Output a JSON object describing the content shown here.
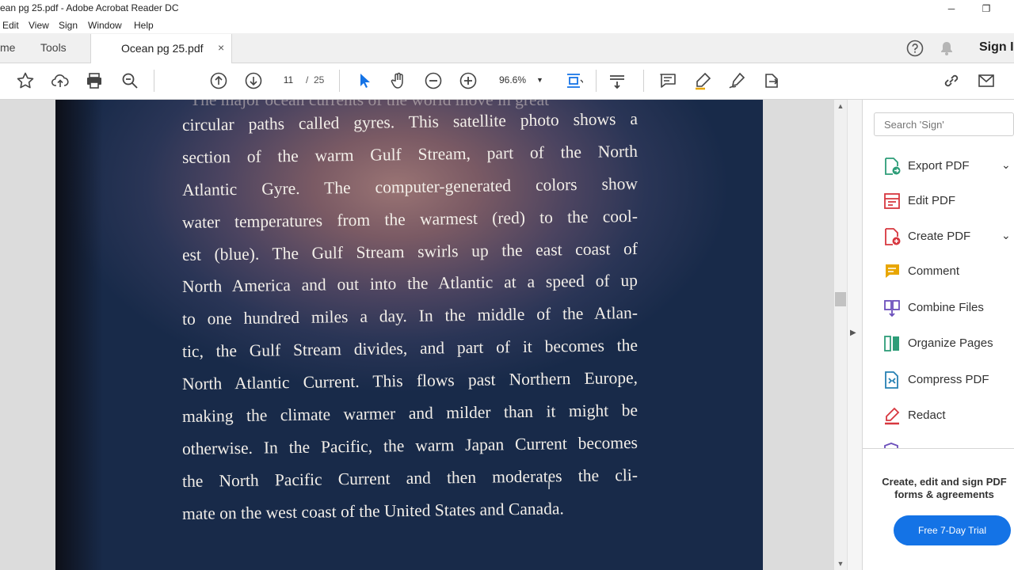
{
  "window": {
    "title": "ean pg 25.pdf - Adobe Acrobat Reader DC",
    "minimize_glyph": "─",
    "restore_glyph": "❐"
  },
  "menu": [
    "Edit",
    "View",
    "Sign",
    "Window",
    "Help"
  ],
  "tabs": {
    "home_label": "me",
    "tools_label": "Tools",
    "document_label": "Ocean pg 25.pdf",
    "close_glyph": "×"
  },
  "header": {
    "sign_in_label": "Sign I"
  },
  "toolbar": {
    "current_page": "11",
    "page_separator": "/",
    "total_pages": "25",
    "zoom": "96.6%",
    "icons": [
      "bookmark-star-icon",
      "upload-cloud-icon",
      "print-icon",
      "search-zoom-icon",
      "page-up-icon",
      "page-down-icon",
      "select-cursor-icon",
      "hand-pan-icon",
      "zoom-out-icon",
      "zoom-in-icon",
      "fit-page-icon",
      "scroll-mode-icon",
      "comment-icon",
      "highlight-pen-icon",
      "sign-icon",
      "share-icon",
      "link-icon",
      "email-icon"
    ]
  },
  "document": {
    "cut_top_line": "The major ocean currents of the world move in great",
    "lines": [
      "circular paths called gyres. This satellite photo shows a",
      "section of the warm Gulf Stream, part of the North",
      "Atlantic Gyre. The computer-generated colors show",
      "water temperatures from the warmest (red) to the cool-",
      "est (blue). The Gulf Stream swirls up the east coast of",
      "North America and out into the Atlantic at a speed of up",
      "to one hundred miles a day. In the middle of the Atlan-",
      "tic, the Gulf Stream divides, and part of it becomes the",
      "North Atlantic Current. This flows past Northern Europe,",
      "making the climate warmer and milder than it might be",
      "otherwise. In the Pacific, the warm Japan Current becomes",
      "the North Pacific Current and then moderates the cli-",
      "mate on the west coast of the United States and Canada."
    ]
  },
  "scrollbar": {
    "up_glyph": "▲",
    "down_glyph": "▼",
    "pane_toggle_glyph": "▶"
  },
  "right_pane": {
    "search_placeholder": "Search 'Sign'",
    "items": [
      {
        "label": "Export PDF",
        "icon": "export-pdf-icon",
        "color": "#2d9d78",
        "chevron": "⌄"
      },
      {
        "label": "Edit PDF",
        "icon": "edit-pdf-icon",
        "color": "#d7373f",
        "chevron": ""
      },
      {
        "label": "Create PDF",
        "icon": "create-pdf-icon",
        "color": "#d7373f",
        "chevron": "⌄"
      },
      {
        "label": "Comment",
        "icon": "comment-tool-icon",
        "color": "#e8a600",
        "chevron": ""
      },
      {
        "label": "Combine Files",
        "icon": "combine-files-icon",
        "color": "#6b4fbb",
        "chevron": ""
      },
      {
        "label": "Organize Pages",
        "icon": "organize-pages-icon",
        "color": "#2d9d78",
        "chevron": ""
      },
      {
        "label": "Compress PDF",
        "icon": "compress-pdf-icon",
        "color": "#2680b3",
        "chevron": ""
      },
      {
        "label": "Redact",
        "icon": "redact-icon",
        "color": "#d7373f",
        "chevron": ""
      }
    ],
    "promo_text": "Create, edit and sign PDF forms & agreements",
    "trial_button_label": "Free 7-Day Trial",
    "accent_color": "#1473e6"
  }
}
